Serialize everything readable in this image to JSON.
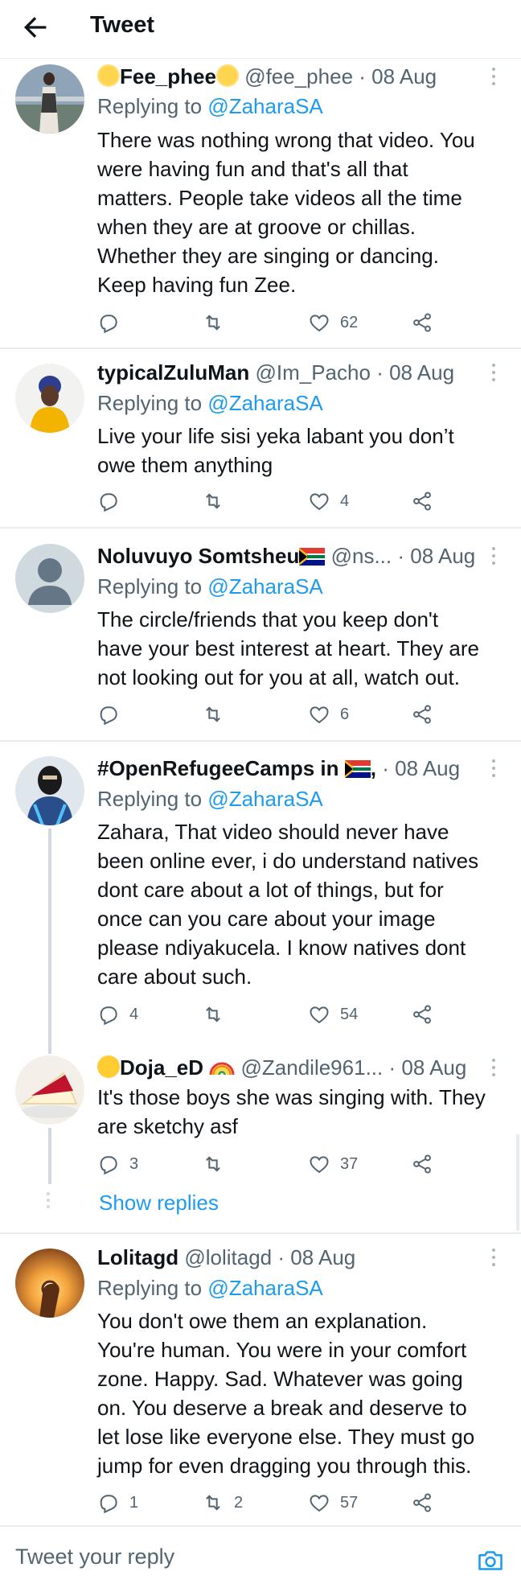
{
  "header": {
    "title": "Tweet",
    "back_icon": "arrow-left-icon"
  },
  "tweets": [
    {
      "name": "Fee_phee",
      "handle": "@fee_phee",
      "sep": "·",
      "date": "08 Aug",
      "replying_label": "Replying to",
      "replying_handle": "@ZaharaSA",
      "lines": [
        "There was nothing wrong that video. You",
        "were having fun and that's all that",
        "matters. People take videos all the time",
        "when they are at groove or chillas.",
        "Whether they are singing or dancing.",
        "Keep having fun Zee."
      ],
      "replies": "",
      "retweets": "",
      "likes": "62"
    },
    {
      "name": "typicalZuluMan",
      "handle": "@Im_Pacho",
      "sep": "·",
      "date": "08 Aug",
      "replying_label": "Replying to",
      "replying_handle": "@ZaharaSA",
      "lines": [
        "Live your life sisi yeka labant you don’t",
        "owe them anything"
      ],
      "replies": "",
      "retweets": "",
      "likes": "4"
    },
    {
      "name": "Noluvuyo Somtsheu",
      "handle": "@ns...",
      "sep": "·",
      "date": "08 Aug",
      "replying_label": "Replying to",
      "replying_handle": "@ZaharaSA",
      "lines": [
        "The circle/friends that you keep don't",
        "have your best interest at heart. They are",
        "not looking out for you at all, watch out."
      ],
      "replies": "",
      "retweets": "",
      "likes": "6"
    },
    {
      "name": "#OpenRefugeeCamps in",
      "handle": ",",
      "sep": "·",
      "date": "08 Aug",
      "replying_label": "Replying to",
      "replying_handle": "@ZaharaSA",
      "lines": [
        "Zahara, That video should never have",
        "been online ever, i do understand natives",
        "dont care about a lot of things, but for",
        "once can you care about your image",
        "please ndiyakucela. I know natives dont",
        "care about such."
      ],
      "replies": "4",
      "retweets": "",
      "likes": "54"
    },
    {
      "name": "Doja_eD",
      "handle": "@Zandile961...",
      "sep": "·",
      "date": "08 Aug",
      "lines": [
        "It's those boys she was singing with. They",
        "are sketchy asf"
      ],
      "replies": "3",
      "retweets": "",
      "likes": "37"
    },
    {
      "name": "Lolitagd",
      "handle": "@lolitagd",
      "sep": "·",
      "date": "08 Aug",
      "replying_label": "Replying to",
      "replying_handle": "@ZaharaSA",
      "lines": [
        "You don't owe them an explanation.",
        "You're human. You were in your comfort",
        "zone. Happy. Sad. Whatever was going",
        "on. You deserve a break and deserve to",
        "let lose like everyone else. They must go",
        "jump for even dragging you through this."
      ],
      "replies": "1",
      "retweets": "2",
      "likes": "57"
    }
  ],
  "show_replies": "Show replies",
  "composer": {
    "placeholder": "Tweet your reply",
    "camera_icon": "camera-icon"
  },
  "colors": {
    "accent": "#1d9bf0",
    "text": "#0f1419",
    "secondary": "#536471",
    "divider": "#e6ecf0"
  }
}
